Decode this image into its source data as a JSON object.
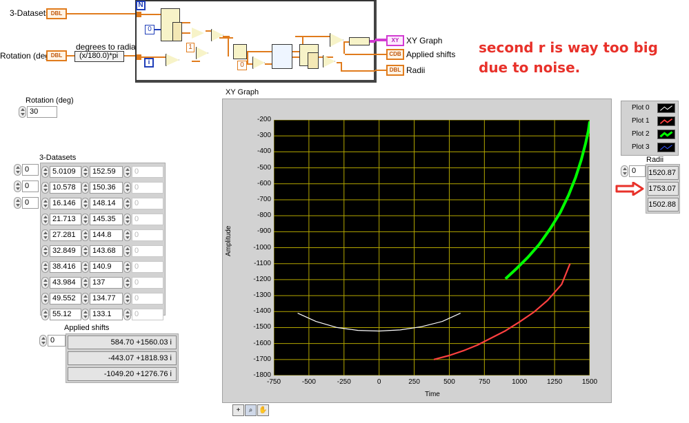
{
  "block_diagram": {
    "N_label": "N",
    "i_label": "i",
    "controls": [
      {
        "label": "3-Datasets",
        "type": "DBL"
      },
      {
        "label": "Rotation (deg)",
        "type": "DBL"
      }
    ],
    "formula_node_label": "degrees to radians",
    "formula": "(x/180.0)*pi",
    "constants": {
      "zero_a": "0",
      "one": "1",
      "zero_b": "0"
    },
    "indicators": [
      {
        "label": "XY Graph",
        "type": "XY"
      },
      {
        "label": "Applied shifts",
        "type": "CDB"
      },
      {
        "label": "Radii",
        "type": "DBL"
      }
    ]
  },
  "annotation": {
    "line1": "second r is way too big",
    "line2": "due to noise."
  },
  "rotation": {
    "label": "Rotation (deg)",
    "value": "30"
  },
  "datasets": {
    "label": "3-Datasets",
    "indices": [
      "0",
      "0",
      "0"
    ],
    "rows": [
      {
        "a": "5.0109",
        "b": "152.59",
        "c": "0"
      },
      {
        "a": "10.578",
        "b": "150.36",
        "c": "0"
      },
      {
        "a": "16.146",
        "b": "148.14",
        "c": "0"
      },
      {
        "a": "21.713",
        "b": "145.35",
        "c": "0"
      },
      {
        "a": "27.281",
        "b": "144.8",
        "c": "0"
      },
      {
        "a": "32.849",
        "b": "143.68",
        "c": "0"
      },
      {
        "a": "38.416",
        "b": "140.9",
        "c": "0"
      },
      {
        "a": "43.984",
        "b": "137",
        "c": "0"
      },
      {
        "a": "49.552",
        "b": "134.77",
        "c": "0"
      },
      {
        "a": "55.12",
        "b": "133.1",
        "c": "0"
      }
    ]
  },
  "applied_shifts": {
    "label": "Applied shifts",
    "index": "0",
    "values": [
      "584.70 +1560.03 i",
      "-443.07 +1818.93 i",
      "-1049.20 +1276.76 i"
    ]
  },
  "radii": {
    "label": "Radii",
    "index": "0",
    "values": [
      "1520.87",
      "1753.07",
      "1502.88"
    ],
    "arrow_color": "#e8312a"
  },
  "legend": [
    {
      "label": "Plot 0",
      "color": "#ffffff"
    },
    {
      "label": "Plot 1",
      "color": "#ff4040"
    },
    {
      "label": "Plot 2",
      "color": "#00ff00"
    },
    {
      "label": "Plot 3",
      "color": "#3355ff"
    }
  ],
  "chart_data": {
    "type": "line",
    "title": "XY Graph",
    "xlabel": "Time",
    "ylabel": "Amplitude",
    "xlim": [
      -750,
      1500
    ],
    "ylim": [
      -1800,
      -200
    ],
    "xticks": [
      "-750",
      "-500",
      "-250",
      "0",
      "250",
      "500",
      "750",
      "1000",
      "1250",
      "1500"
    ],
    "yticks": [
      "-200",
      "-300",
      "-400",
      "-500",
      "-600",
      "-700",
      "-800",
      "-900",
      "-1000",
      "-1100",
      "-1200",
      "-1300",
      "-1400",
      "-1500",
      "-1600",
      "-1700",
      "-1800"
    ],
    "grid": true,
    "background": "#000000",
    "grid_color": "#b5a800",
    "series": [
      {
        "name": "Plot 0",
        "color": "#ffffff",
        "x": [
          -580,
          -450,
          -300,
          -150,
          0,
          150,
          300,
          450,
          580
        ],
        "y": [
          -1410,
          -1462,
          -1500,
          -1518,
          -1522,
          -1515,
          -1495,
          -1462,
          -1410
        ]
      },
      {
        "name": "Plot 1",
        "color": "#ff4040",
        "x": [
          390,
          500,
          600,
          700,
          800,
          900,
          1000,
          1100,
          1200,
          1300,
          1360
        ],
        "y": [
          -1700,
          -1675,
          -1645,
          -1610,
          -1565,
          -1520,
          -1465,
          -1405,
          -1330,
          -1230,
          -1100
        ]
      },
      {
        "name": "Plot 2",
        "color": "#00ff00",
        "x": [
          900,
          980,
          1060,
          1140,
          1220,
          1290,
          1350,
          1400,
          1440,
          1470,
          1490,
          1500
        ],
        "y": [
          -1195,
          -1130,
          -1060,
          -980,
          -880,
          -780,
          -670,
          -560,
          -450,
          -350,
          -270,
          -210
        ]
      }
    ]
  }
}
